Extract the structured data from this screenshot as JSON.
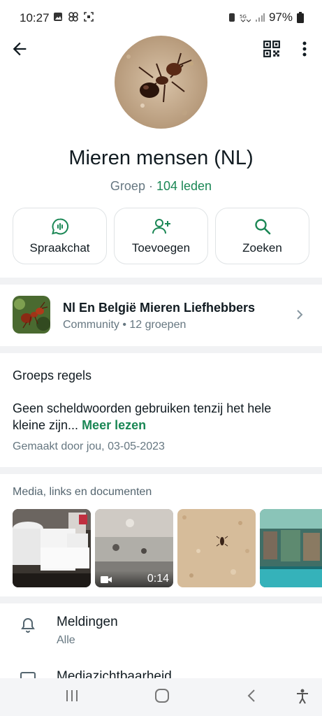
{
  "status_bar": {
    "time": "10:27",
    "battery": "97%",
    "network": "5G"
  },
  "header": {
    "icons": [
      "back-arrow-icon",
      "qr-code-icon",
      "more-vert-icon"
    ]
  },
  "group": {
    "name": "Mieren mensen (NL)",
    "type_label": "Groep",
    "separator": "·",
    "members_label": "104 leden"
  },
  "actions": [
    {
      "label": "Spraakchat",
      "icon": "voice-chat-icon"
    },
    {
      "label": "Toevoegen",
      "icon": "add-person-icon"
    },
    {
      "label": "Zoeken",
      "icon": "search-icon"
    }
  ],
  "community": {
    "title": "Nl En België Mieren Liefhebbers",
    "subtitle": "Community • 12 groepen"
  },
  "rules": {
    "title": "Groeps regels",
    "body": "Geen scheldwoorden gebruiken tenzij het hele kleine zijn...",
    "read_more": "Meer lezen",
    "meta": "Gemaakt door jou, 03-05-2023"
  },
  "media": {
    "title": "Media, links en documenten",
    "video_duration": "0:14"
  },
  "settings": [
    {
      "label": "Meldingen",
      "value": "Alle",
      "icon": "bell-icon"
    },
    {
      "label": "Mediazichtbaarheid",
      "value": "",
      "icon": "media-visibility-icon"
    }
  ],
  "colors": {
    "accent": "#1b8755",
    "text_primary": "#111b21",
    "text_secondary": "#667781",
    "divider": "#f1f2f4"
  }
}
